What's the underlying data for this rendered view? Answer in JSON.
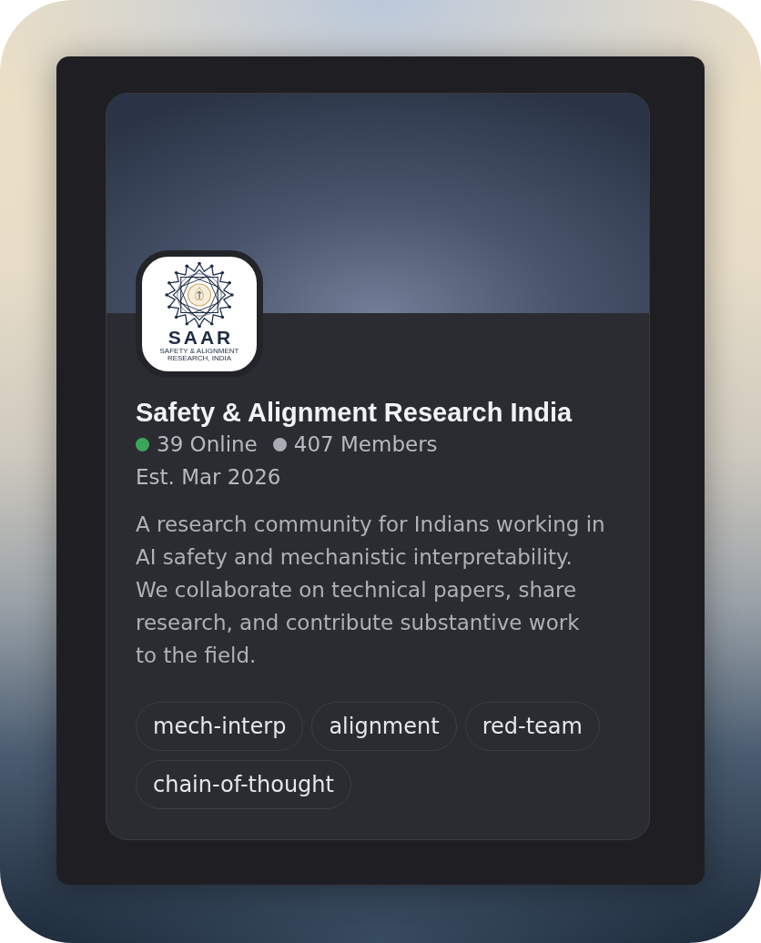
{
  "server": {
    "logo": {
      "wordmark": "SAAR",
      "tagline": "SAFETY & ALIGNMENT RESEARCH, INDIA"
    },
    "name": "Safety & Alignment Research India",
    "stats": [
      {
        "label": "39 Online",
        "color": "#3ba55d"
      },
      {
        "label": "407 Members",
        "color": "#a9acb4"
      }
    ],
    "established": "Est. Mar 2026",
    "description": "A research community for Indians working in AI safety and mechanistic interpretability. We collaborate on technical papers, share research, and contribute substantive work to the field.",
    "tags": [
      "mech-interp",
      "alignment",
      "red-team",
      "chain-of-thought"
    ]
  }
}
